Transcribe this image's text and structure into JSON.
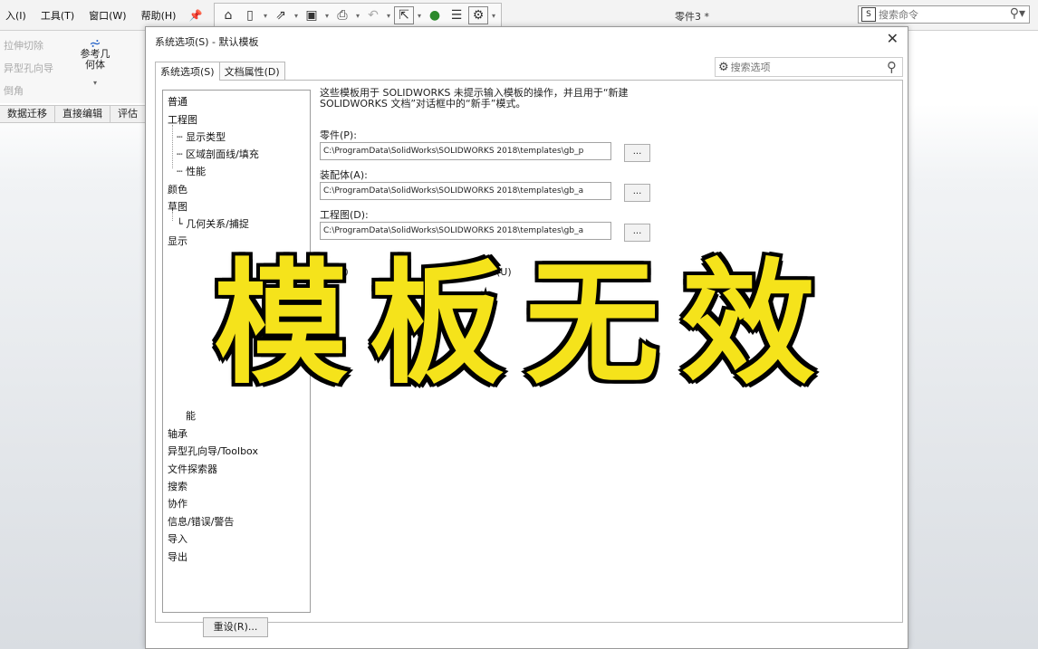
{
  "menus": [
    "入(I)",
    "工具(T)",
    "窗口(W)",
    "帮助(H)"
  ],
  "quick_access": [
    "home-icon",
    "new-doc-icon",
    "open-icon",
    "save-icon",
    "print-icon",
    "undo-icon",
    "select-icon",
    "traffic-light-icon",
    "file-props-icon",
    "options-icon"
  ],
  "doc_title": "零件3 *",
  "command_search": {
    "placeholder": "搜索命令"
  },
  "command_manager": {
    "features": [
      "拉伸切除",
      "异型孔向导",
      "倒角"
    ],
    "ref_geometry": "参考几\n何体",
    "tabs": [
      "数据迁移",
      "直接编辑",
      "评估"
    ]
  },
  "dialog": {
    "title": "系统选项(S) - 默认模板",
    "tabs": [
      "系统选项(S)",
      "文档属性(D)"
    ],
    "options_search": {
      "placeholder": "搜索选项"
    },
    "tree": {
      "top": [
        "普通",
        "工程图"
      ],
      "drawing_children": [
        "显示类型",
        "区域剖面线/填充",
        "性能"
      ],
      "mid": [
        "颜色",
        "草图"
      ],
      "sketch_children": [
        "几何关系/捕捉"
      ],
      "display": "显示",
      "partial": "能",
      "bottom": [
        "轴承",
        "异型孔向导/Toolbox",
        "文件探索器",
        "搜索",
        "协作",
        "信息/错误/警告",
        "导入",
        "导出"
      ]
    },
    "description": "这些模板用于 SOLIDWORKS 未提示输入模板的操作，并且用于“新建 SOLIDWORKS 文档”对话框中的“新手”模式。",
    "fields": [
      {
        "label": "零件(P):",
        "path": "C:\\ProgramData\\SolidWorks\\SOLIDWORKS 2018\\templates\\gb_p"
      },
      {
        "label": "装配体(A):",
        "path": "C:\\ProgramData\\SolidWorks\\SOLIDWORKS 2018\\templates\\gb_a"
      },
      {
        "label": "工程图(D):",
        "path": "C:\\ProgramData\\SolidWorks\\SOLIDWORKS 2018\\templates\\gb_a"
      }
    ],
    "browse_label": "...",
    "radio_partial": "(U)",
    "reset_label": "重设(R)..."
  },
  "overlay_text": "模板无效",
  "colors": {
    "overlay_fill": "#f5e31b",
    "overlay_stroke": "#000000"
  }
}
